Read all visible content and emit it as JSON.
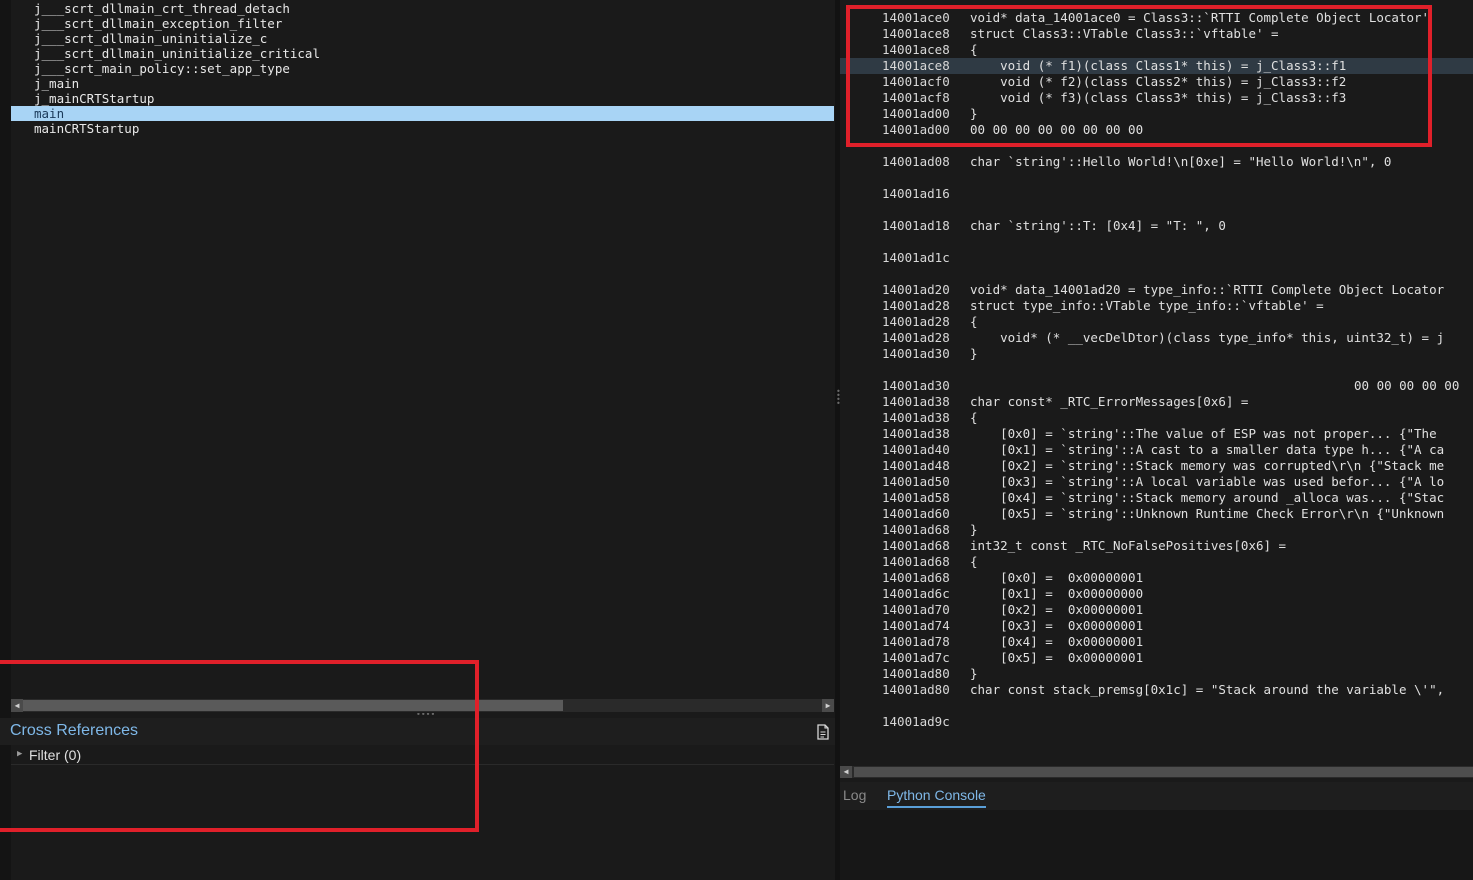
{
  "symbols": {
    "items": [
      "j___scrt_dllmain_crt_thread_detach",
      "j___scrt_dllmain_exception_filter",
      "j___scrt_dllmain_uninitialize_c",
      "j___scrt_dllmain_uninitialize_critical",
      "j___scrt_main_policy::set_app_type",
      "j_main",
      "j_mainCRTStartup",
      "main",
      "mainCRTStartup"
    ],
    "selected": "main"
  },
  "xref": {
    "title": "Cross References",
    "filter_label": "Filter (0)"
  },
  "linear_view": {
    "lines": [
      {
        "addr": "14001ace0",
        "code": "void* data_14001ace0 = Class3::`RTTI Complete Object Locator'"
      },
      {
        "addr": "14001ace8",
        "code": "struct Class3::VTable Class3::`vftable' ="
      },
      {
        "addr": "14001ace8",
        "code": "{"
      },
      {
        "addr": "14001ace8",
        "code": "    void (* f1)(class Class1* this) = j_Class3::f1"
      },
      {
        "addr": "14001acf0",
        "code": "    void (* f2)(class Class2* this) = j_Class3::f2"
      },
      {
        "addr": "14001acf8",
        "code": "    void (* f3)(class Class3* this) = j_Class3::f3"
      },
      {
        "addr": "14001ad00",
        "code": "}"
      },
      {
        "addr": "14001ad00",
        "code": "00 00 00 00 00 00 00 00"
      },
      {
        "addr": "",
        "code": ""
      },
      {
        "addr": "14001ad08",
        "code": "char `string'::Hello World!\\n[0xe] = \"Hello World!\\n\", 0"
      },
      {
        "addr": "",
        "code": ""
      },
      {
        "addr": "14001ad16",
        "code": ""
      },
      {
        "addr": "",
        "code": ""
      },
      {
        "addr": "14001ad18",
        "code": "char `string'::T: [0x4] = \"T: \", 0"
      },
      {
        "addr": "",
        "code": ""
      },
      {
        "addr": "14001ad1c",
        "code": ""
      },
      {
        "addr": "",
        "code": ""
      },
      {
        "addr": "14001ad20",
        "code": "void* data_14001ad20 = type_info::`RTTI Complete Object Locator"
      },
      {
        "addr": "14001ad28",
        "code": "struct type_info::VTable type_info::`vftable' ="
      },
      {
        "addr": "14001ad28",
        "code": "{"
      },
      {
        "addr": "14001ad28",
        "code": "    void* (* __vecDelDtor)(class type_info* this, uint32_t) = j"
      },
      {
        "addr": "14001ad30",
        "code": "}"
      },
      {
        "addr": "",
        "code": ""
      },
      {
        "addr": "14001ad30",
        "code": "00 00 00 00 00"
      },
      {
        "addr": "14001ad38",
        "code": "char const* _RTC_ErrorMessages[0x6] ="
      },
      {
        "addr": "14001ad38",
        "code": "{"
      },
      {
        "addr": "14001ad38",
        "code": "    [0x0] = `string'::The value of ESP was not proper... {\"The"
      },
      {
        "addr": "14001ad40",
        "code": "    [0x1] = `string'::A cast to a smaller data type h... {\"A ca"
      },
      {
        "addr": "14001ad48",
        "code": "    [0x2] = `string'::Stack memory was corrupted\\r\\n {\"Stack me"
      },
      {
        "addr": "14001ad50",
        "code": "    [0x3] = `string'::A local variable was used befor... {\"A lo"
      },
      {
        "addr": "14001ad58",
        "code": "    [0x4] = `string'::Stack memory around _alloca was... {\"Stac"
      },
      {
        "addr": "14001ad60",
        "code": "    [0x5] = `string'::Unknown Runtime Check Error\\r\\n {\"Unknown"
      },
      {
        "addr": "14001ad68",
        "code": "}"
      },
      {
        "addr": "14001ad68",
        "code": "int32_t const _RTC_NoFalsePositives[0x6] ="
      },
      {
        "addr": "14001ad68",
        "code": "{"
      },
      {
        "addr": "14001ad68",
        "code": "    [0x0] =  0x00000001"
      },
      {
        "addr": "14001ad6c",
        "code": "    [0x1] =  0x00000000"
      },
      {
        "addr": "14001ad70",
        "code": "    [0x2] =  0x00000001"
      },
      {
        "addr": "14001ad74",
        "code": "    [0x3] =  0x00000001"
      },
      {
        "addr": "14001ad78",
        "code": "    [0x4] =  0x00000001"
      },
      {
        "addr": "14001ad7c",
        "code": "    [0x5] =  0x00000001"
      },
      {
        "addr": "14001ad80",
        "code": "}"
      },
      {
        "addr": "14001ad80",
        "code": "char const stack_premsg[0x1c] = \"Stack around the variable \\'\","
      },
      {
        "addr": "",
        "code": ""
      },
      {
        "addr": "14001ad9c",
        "code": ""
      }
    ],
    "highlighted_index": 3
  },
  "bottom_tabs": {
    "log": "Log",
    "python_console": "Python Console",
    "active": "Python Console"
  },
  "colors": {
    "selection": "#a8d4f5",
    "accent": "#7fb8e8",
    "annotation": "#e0202a",
    "string_literal": "#e8c87a"
  },
  "icons": [
    "document-icon",
    "chevron-right-icon",
    "scroll-left-icon",
    "scroll-right-icon"
  ]
}
